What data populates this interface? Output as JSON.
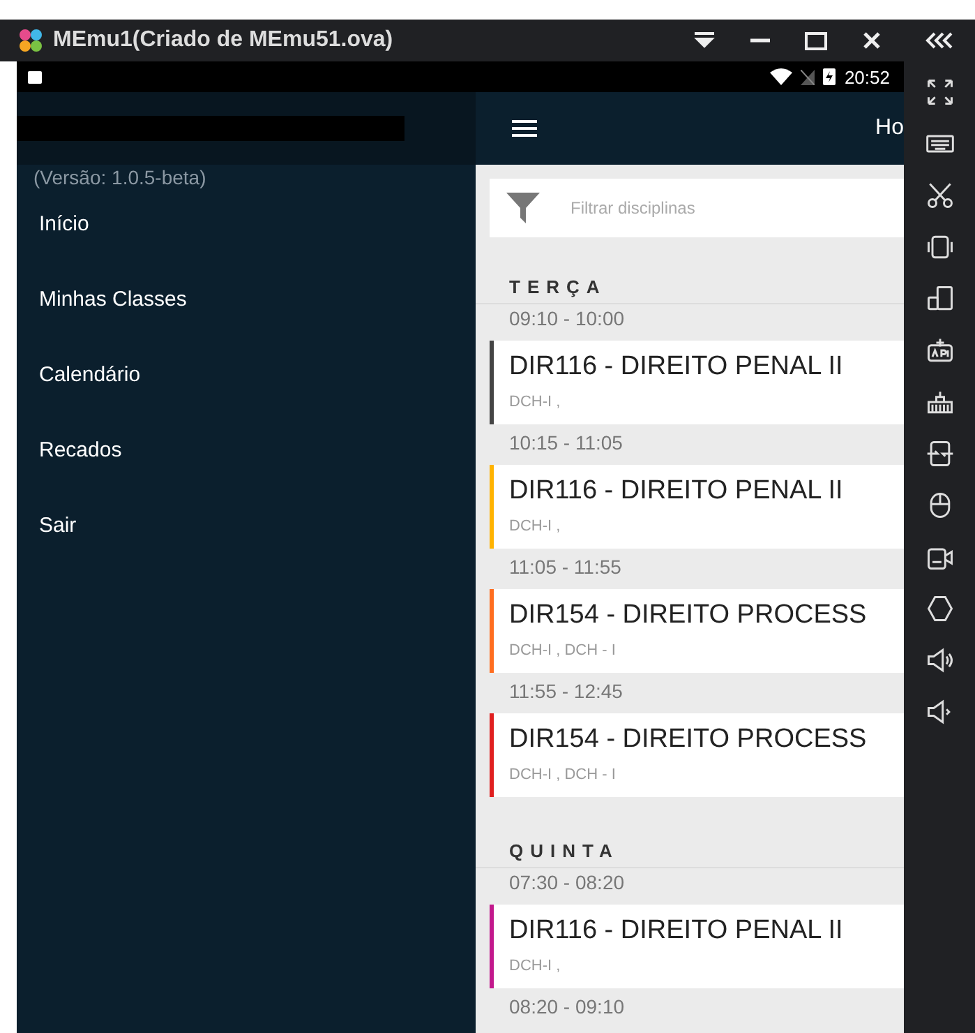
{
  "window": {
    "title": "MEmu1(Criado de MEmu51.ova)"
  },
  "status_bar": {
    "time": "20:52"
  },
  "drawer": {
    "version": "(Versão: 1.0.5-beta)",
    "items": [
      {
        "label": "Início"
      },
      {
        "label": "Minhas Classes"
      },
      {
        "label": "Calendário"
      },
      {
        "label": "Recados"
      },
      {
        "label": "Sair"
      }
    ]
  },
  "app_bar": {
    "title": "Ho"
  },
  "filter": {
    "placeholder": "Filtrar disciplinas"
  },
  "days": [
    {
      "name": "TERÇA",
      "slots": [
        {
          "time": "09:10 - 10:00",
          "title": "DIR116 - DIREITO PENAL II",
          "room": "DCH-I ,",
          "color": "#444444"
        },
        {
          "time": "10:15 - 11:05",
          "title": "DIR116 - DIREITO PENAL II",
          "room": "DCH-I ,",
          "color": "#ffb300"
        },
        {
          "time": "11:05 - 11:55",
          "title": "DIR154 - DIREITO PROCESS",
          "room": "DCH-I , DCH - I",
          "color": "#ff6d1f"
        },
        {
          "time": "11:55 - 12:45",
          "title": "DIR154 - DIREITO PROCESS",
          "room": "DCH-I , DCH - I",
          "color": "#e01f1f"
        }
      ]
    },
    {
      "name": "QUINTA",
      "slots": [
        {
          "time": "07:30 - 08:20",
          "title": "DIR116 - DIREITO PENAL II",
          "room": "DCH-I ,",
          "color": "#c2188c"
        },
        {
          "time": "08:20 - 09:10"
        }
      ]
    }
  ]
}
